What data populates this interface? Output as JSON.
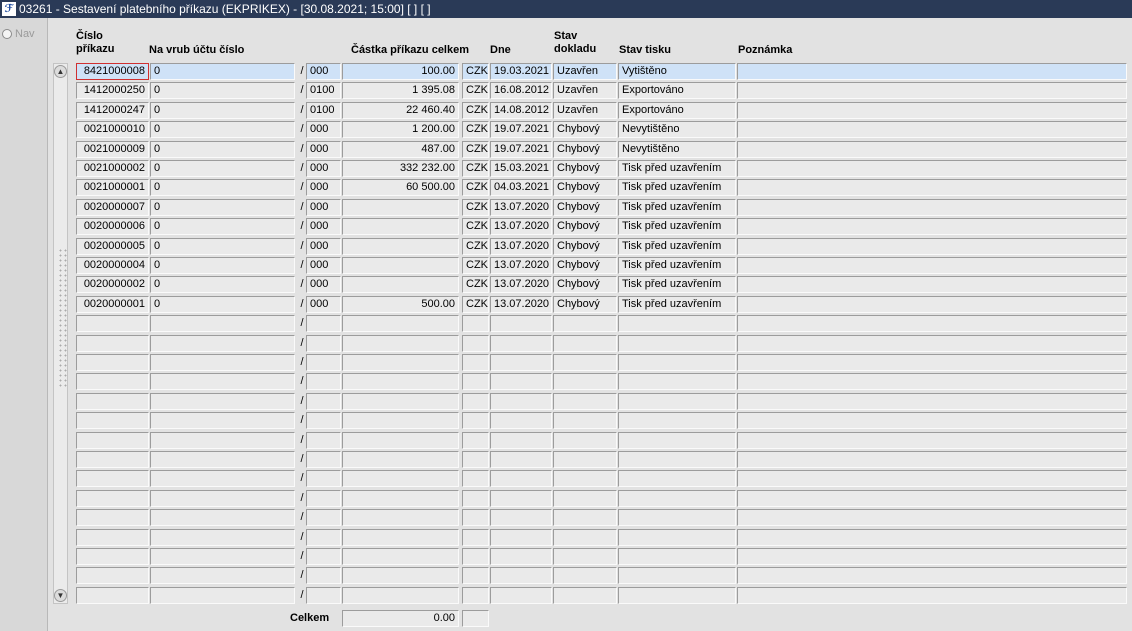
{
  "window": {
    "title": "03261 - Sestavení platebního příkazu (EKPRIKEX) - [30.08.2021; 15:00]  [ ] [ ]",
    "icon": "app-logo-icon"
  },
  "nav": {
    "label": "Nav"
  },
  "headers": {
    "order_no_1": "Číslo",
    "order_no_2": "příkazu",
    "debit_account": "Na vrub účtu číslo",
    "amount": "Částka příkazu celkem",
    "date": "Dne",
    "doc_status_1": "Stav",
    "doc_status_2": "dokladu",
    "print_status": "Stav tisku",
    "note": "Poznámka"
  },
  "separator": "/",
  "rows": [
    {
      "number": "8421000008",
      "account": "0",
      "bank": "000",
      "amount": "100.00",
      "currency": "CZK",
      "date": "19.03.2021",
      "doc_status": "Uzavřen",
      "print_status": "Vytištěno",
      "note": ""
    },
    {
      "number": "1412000250",
      "account": "0",
      "bank": "0100",
      "amount": "1 395.08",
      "currency": "CZK",
      "date": "16.08.2012",
      "doc_status": "Uzavřen",
      "print_status": "Exportováno",
      "note": ""
    },
    {
      "number": "1412000247",
      "account": "0",
      "bank": "0100",
      "amount": "22 460.40",
      "currency": "CZK",
      "date": "14.08.2012",
      "doc_status": "Uzavřen",
      "print_status": "Exportováno",
      "note": ""
    },
    {
      "number": "0021000010",
      "account": "0",
      "bank": "000",
      "amount": "1 200.00",
      "currency": "CZK",
      "date": "19.07.2021",
      "doc_status": "Chybový",
      "print_status": "Nevytištěno",
      "note": ""
    },
    {
      "number": "0021000009",
      "account": "0",
      "bank": "000",
      "amount": "487.00",
      "currency": "CZK",
      "date": "19.07.2021",
      "doc_status": "Chybový",
      "print_status": "Nevytištěno",
      "note": ""
    },
    {
      "number": "0021000002",
      "account": "0",
      "bank": "000",
      "amount": "332 232.00",
      "currency": "CZK",
      "date": "15.03.2021",
      "doc_status": "Chybový",
      "print_status": "Tisk před uzavřením",
      "note": ""
    },
    {
      "number": "0021000001",
      "account": "0",
      "bank": "000",
      "amount": "60 500.00",
      "currency": "CZK",
      "date": "04.03.2021",
      "doc_status": "Chybový",
      "print_status": "Tisk před uzavřením",
      "note": ""
    },
    {
      "number": "0020000007",
      "account": "0",
      "bank": "000",
      "amount": "",
      "currency": "CZK",
      "date": "13.07.2020",
      "doc_status": "Chybový",
      "print_status": "Tisk před uzavřením",
      "note": ""
    },
    {
      "number": "0020000006",
      "account": "0",
      "bank": "000",
      "amount": "",
      "currency": "CZK",
      "date": "13.07.2020",
      "doc_status": "Chybový",
      "print_status": "Tisk před uzavřením",
      "note": ""
    },
    {
      "number": "0020000005",
      "account": "0",
      "bank": "000",
      "amount": "",
      "currency": "CZK",
      "date": "13.07.2020",
      "doc_status": "Chybový",
      "print_status": "Tisk před uzavřením",
      "note": ""
    },
    {
      "number": "0020000004",
      "account": "0",
      "bank": "000",
      "amount": "",
      "currency": "CZK",
      "date": "13.07.2020",
      "doc_status": "Chybový",
      "print_status": "Tisk před uzavřením",
      "note": ""
    },
    {
      "number": "0020000002",
      "account": "0",
      "bank": "000",
      "amount": "",
      "currency": "CZK",
      "date": "13.07.2020",
      "doc_status": "Chybový",
      "print_status": "Tisk před uzavřením",
      "note": ""
    },
    {
      "number": "0020000001",
      "account": "0",
      "bank": "000",
      "amount": "500.00",
      "currency": "CZK",
      "date": "13.07.2020",
      "doc_status": "Chybový",
      "print_status": "Tisk před uzavřením",
      "note": ""
    },
    {
      "number": "",
      "account": "",
      "bank": "",
      "amount": "",
      "currency": "",
      "date": "",
      "doc_status": "",
      "print_status": "",
      "note": ""
    },
    {
      "number": "",
      "account": "",
      "bank": "",
      "amount": "",
      "currency": "",
      "date": "",
      "doc_status": "",
      "print_status": "",
      "note": ""
    },
    {
      "number": "",
      "account": "",
      "bank": "",
      "amount": "",
      "currency": "",
      "date": "",
      "doc_status": "",
      "print_status": "",
      "note": ""
    },
    {
      "number": "",
      "account": "",
      "bank": "",
      "amount": "",
      "currency": "",
      "date": "",
      "doc_status": "",
      "print_status": "",
      "note": ""
    },
    {
      "number": "",
      "account": "",
      "bank": "",
      "amount": "",
      "currency": "",
      "date": "",
      "doc_status": "",
      "print_status": "",
      "note": ""
    },
    {
      "number": "",
      "account": "",
      "bank": "",
      "amount": "",
      "currency": "",
      "date": "",
      "doc_status": "",
      "print_status": "",
      "note": ""
    },
    {
      "number": "",
      "account": "",
      "bank": "",
      "amount": "",
      "currency": "",
      "date": "",
      "doc_status": "",
      "print_status": "",
      "note": ""
    },
    {
      "number": "",
      "account": "",
      "bank": "",
      "amount": "",
      "currency": "",
      "date": "",
      "doc_status": "",
      "print_status": "",
      "note": ""
    },
    {
      "number": "",
      "account": "",
      "bank": "",
      "amount": "",
      "currency": "",
      "date": "",
      "doc_status": "",
      "print_status": "",
      "note": ""
    },
    {
      "number": "",
      "account": "",
      "bank": "",
      "amount": "",
      "currency": "",
      "date": "",
      "doc_status": "",
      "print_status": "",
      "note": ""
    },
    {
      "number": "",
      "account": "",
      "bank": "",
      "amount": "",
      "currency": "",
      "date": "",
      "doc_status": "",
      "print_status": "",
      "note": ""
    },
    {
      "number": "",
      "account": "",
      "bank": "",
      "amount": "",
      "currency": "",
      "date": "",
      "doc_status": "",
      "print_status": "",
      "note": ""
    },
    {
      "number": "",
      "account": "",
      "bank": "",
      "amount": "",
      "currency": "",
      "date": "",
      "doc_status": "",
      "print_status": "",
      "note": ""
    },
    {
      "number": "",
      "account": "",
      "bank": "",
      "amount": "",
      "currency": "",
      "date": "",
      "doc_status": "",
      "print_status": "",
      "note": ""
    },
    {
      "number": "",
      "account": "",
      "bank": "",
      "amount": "",
      "currency": "",
      "date": "",
      "doc_status": "",
      "print_status": "",
      "note": ""
    }
  ],
  "totals": {
    "label": "Celkem",
    "amount": "0.00",
    "currency": ""
  },
  "colors": {
    "titlebar": "#2a3a57",
    "selected_row": "#cfe2f7",
    "focus_border": "#d03030"
  }
}
